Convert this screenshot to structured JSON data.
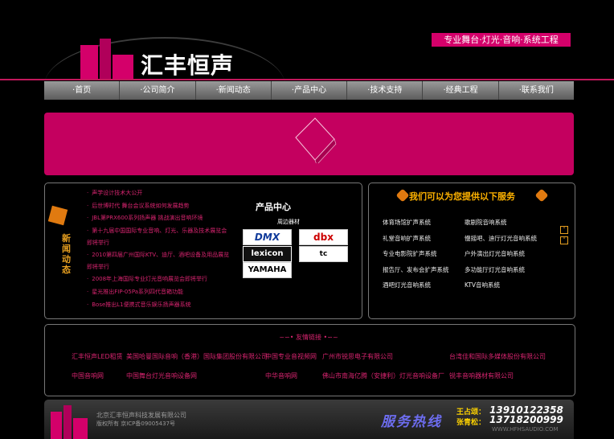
{
  "header": {
    "logo_text": "汇丰恒声",
    "tagline": "专业舞台·灯光·音响·系统工程"
  },
  "nav": {
    "items": [
      "·首页",
      "·公司简介",
      "·新闻动态",
      "·产品中心",
      "·技术支持",
      "·经典工程",
      "·联系我们"
    ]
  },
  "news": {
    "heading": "新闻动态",
    "items": [
      "声学设计技术大公开",
      "后世博时代 舞台会议系统如何发展趋势",
      "JBL第PRX600系列扬声器 挑战演出音响环境",
      "第十九届中国国际专业音响、灯光、乐器及技术展览会即将举行",
      "2010第四届广州国际KTV、迪厅、酒吧设备及用品展览即将举行",
      "2008年上海国际专业灯光音响展览会即将举行",
      "星光推出FIP-05Pa系列四代音箱功能",
      "Bose推出L1便携式音乐娱乐扬声器系统"
    ]
  },
  "products": {
    "title": "产品中心",
    "subtitle": "周边器材",
    "brands": [
      "DMX",
      "dbx",
      "lexicon",
      "tc electronic",
      "YAMAHA"
    ]
  },
  "services": {
    "heading": "我们可以为您提供以下服务",
    "items": [
      "体育场馆扩声系统",
      "歌剧院音响系统",
      "礼堂音响扩声系统",
      "慢摇吧、迪厅灯光音响系统",
      "专业电影院扩声系统",
      "户外演出灯光音响系统",
      "报告厅、发布会扩声系统",
      "多功能厅灯光音响系统",
      "酒吧灯光音响系统",
      "KTV音响系统"
    ]
  },
  "links": {
    "title": "友情链接",
    "row1": [
      "汇丰恒声LED租赁",
      "美国哈曼国际音响（香港）国际集团股份有限公司",
      "中国专业音视频网",
      "广州市锐思电子有限公司",
      "台湾佳和国际多媒体股份有限公司"
    ],
    "row2": [
      "中国音响网",
      "中国舞台灯光音响设备网",
      "中华音响网",
      "佛山市南海亿腾（安捷利）灯光音响设备厂",
      "锐丰音响器材有限公司"
    ]
  },
  "footer": {
    "company": "北京汇丰恒声科技发展有限公司",
    "icp": "版权所有 京ICP备09005437号",
    "hotline": "服务热线",
    "phone1_label": "王占颂：",
    "phone1": "13910122358",
    "phone2_label": "张青松：",
    "phone2": "13718200999",
    "website": "WWW.HFHSAUDIO.COM"
  },
  "colors": {
    "brand_pink": "#d4006a",
    "banner": "#c4005f",
    "accent_orange": "#e07a10"
  }
}
